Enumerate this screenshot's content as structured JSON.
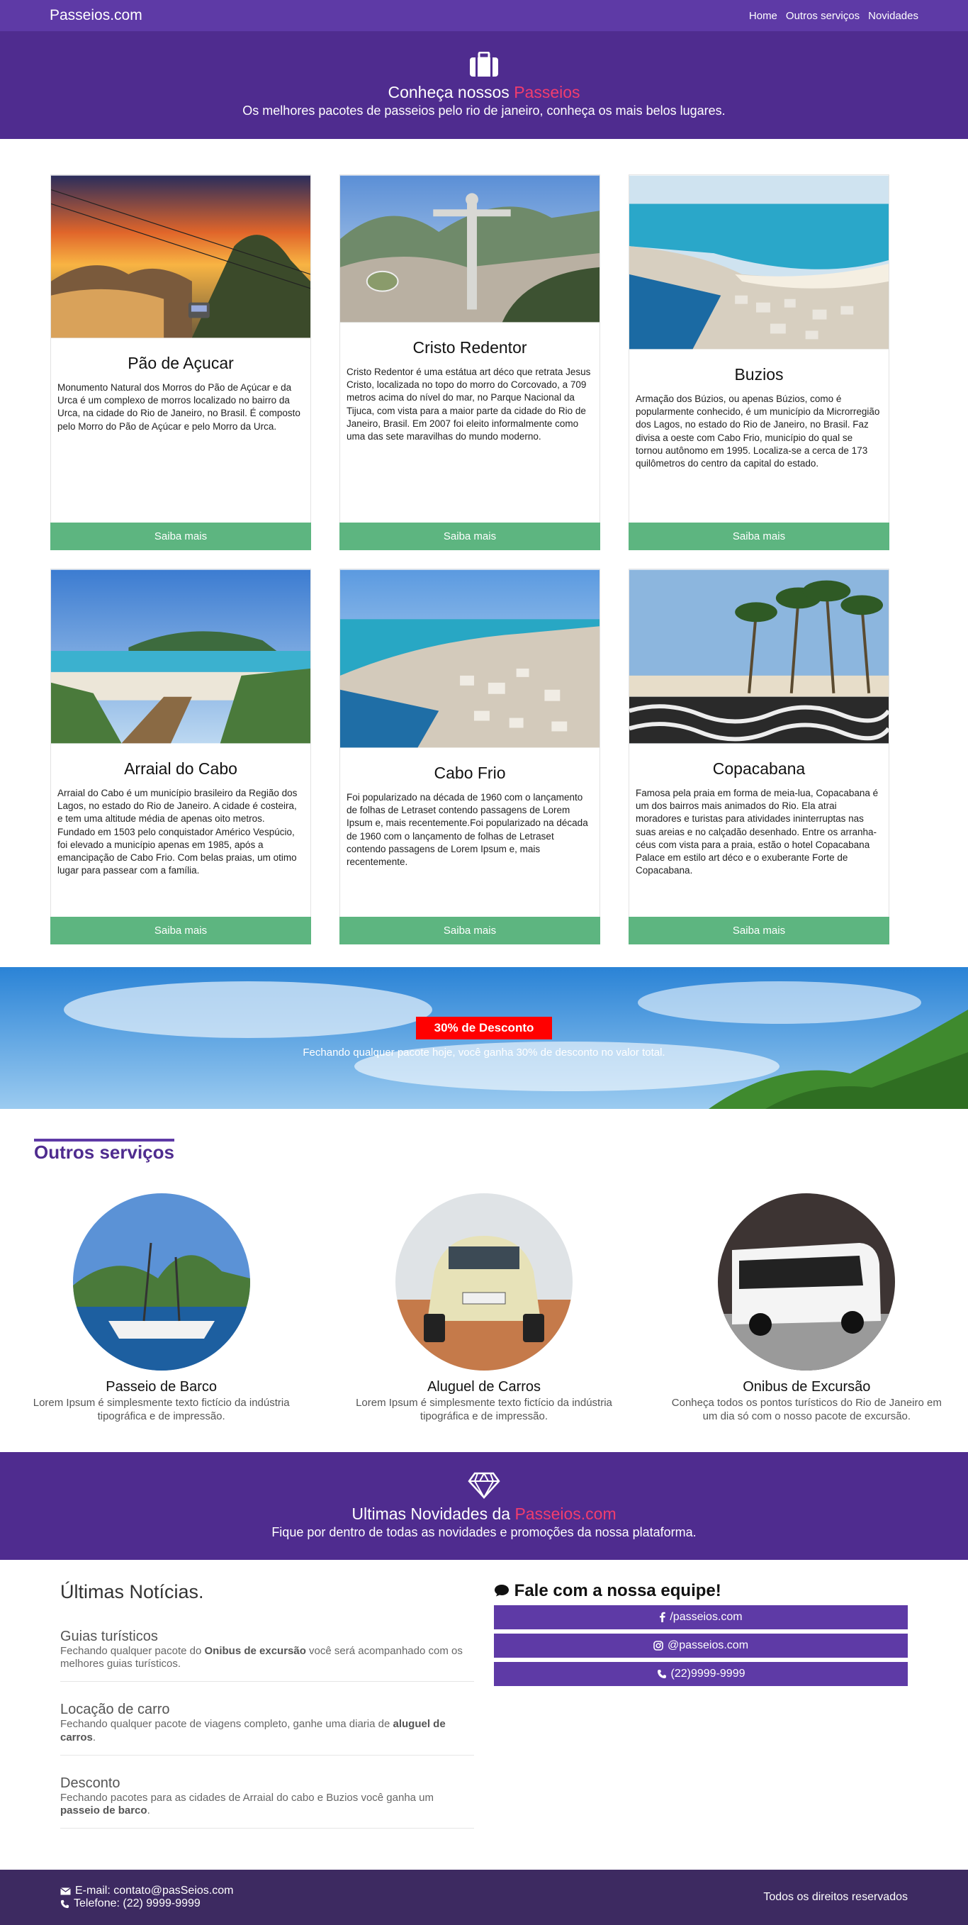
{
  "nav": {
    "brand": "Passeios.com",
    "links": [
      "Home",
      "Outros serviços",
      "Novidades"
    ]
  },
  "hero": {
    "title_prefix": "Conheça nossos ",
    "title_accent": "Passeios",
    "subtitle": "Os melhores pacotes de passeios pelo rio de janeiro, conheça os mais belos lugares."
  },
  "cards": [
    {
      "title": "Pão de Açucar",
      "text": "Monumento Natural dos Morros do Pão de Açúcar e da Urca é um complexo de morros localizado no bairro da Urca, na cidade do Rio de Janeiro, no Brasil. É composto pelo Morro do Pão de Açúcar e pelo Morro da Urca.",
      "button": "Saiba mais"
    },
    {
      "title": "Cristo Redentor",
      "text": "Cristo Redentor é uma estátua art déco que retrata Jesus Cristo, localizada no topo do morro do Corcovado, a 709 metros acima do nível do mar, no Parque Nacional da Tijuca, com vista para a maior parte da cidade do Rio de Janeiro, Brasil. Em 2007 foi eleito informalmente como uma das sete maravilhas do mundo moderno.",
      "button": "Saiba mais"
    },
    {
      "title": "Buzios",
      "text": "Armação dos Búzios, ou apenas Búzios, como é popularmente conhecido, é um município da Microrregião dos Lagos, no estado do Rio de Janeiro, no Brasil. Faz divisa a oeste com Cabo Frio, município do qual se tornou autônomo em 1995. Localiza-se a cerca de 173 quilômetros do centro da capital do estado.",
      "button": "Saiba mais"
    },
    {
      "title": "Arraial do Cabo",
      "text": "Arraial do Cabo é um município brasileiro da Região dos Lagos, no estado do Rio de Janeiro. A cidade é costeira, e tem uma altitude média de apenas oito metros. Fundado em 1503 pelo conquistador Américo Vespúcio, foi elevado a município apenas em 1985, após a emancipação de Cabo Frio. Com belas praias, um otimo lugar para passear com a família.",
      "button": "Saiba mais"
    },
    {
      "title": "Cabo Frio",
      "text": "Foi popularizado na década de 1960 com o lançamento de folhas de Letraset contendo passagens de Lorem Ipsum e, mais recentemente.Foi popularizado na década de 1960 com o lançamento de folhas de Letraset contendo passagens de Lorem Ipsum e, mais recentemente.",
      "button": "Saiba mais"
    },
    {
      "title": "Copacabana",
      "text": "Famosa pela praia em forma de meia-lua, Copacabana é um dos bairros mais animados do Rio. Ela atrai moradores e turistas para atividades ininterruptas nas suas areias e no calçadão desenhado. Entre os arranha-céus com vista para a praia, estão o hotel Copacabana Palace em estilo art déco e o exuberante Forte de Copacabana.",
      "button": "Saiba mais"
    }
  ],
  "promo": {
    "badge": "30% de Desconto",
    "text": "Fechando qualquer pacote hoje, você ganha 30% de desconto no valor total."
  },
  "services": {
    "title": "Outros serviços",
    "items": [
      {
        "title": "Passeio de Barco",
        "text": "Lorem Ipsum é simplesmente texto fictício da indústria tipográfica e de impressão."
      },
      {
        "title": "Aluguel de Carros",
        "text": "Lorem Ipsum é simplesmente texto fictício da indústria tipográfica e de impressão."
      },
      {
        "title": "Onibus de Excursão",
        "text": "Conheça todos os pontos turísticos do Rio de Janeiro em um dia só com o nosso pacote de excursão."
      }
    ]
  },
  "hero2": {
    "title_prefix": "Ultimas Novidades da ",
    "title_accent": "Passeios.com",
    "subtitle": "Fique por dentro de todas as novidades e promoções da nossa plataforma."
  },
  "news": {
    "title": "Últimas Notícias.",
    "items": [
      {
        "title": "Guias turísticos",
        "pre": "Fechando qualquer pacote do ",
        "bold": "Onibus de excursão",
        "post": " você será acompanhado com os melhores guias turísticos."
      },
      {
        "title": "Locação de carro",
        "pre": "Fechando qualquer pacote de viagens completo, ganhe uma diaria de ",
        "bold": "aluguel de carros",
        "post": "."
      },
      {
        "title": "Desconto",
        "pre": "Fechando pacotes para as cidades de Arraial do cabo e Buzios você ganha um ",
        "bold": "passeio de barco",
        "post": "."
      }
    ]
  },
  "contact": {
    "title": "Fale com a nossa equipe!",
    "facebook": "/passeios.com",
    "instagram": "@passeios.com",
    "phone": "(22)9999-9999"
  },
  "footer": {
    "email": "E-mail: contato@pasSeios.com",
    "phone": "Telefone: (22) 9999-9999",
    "rights": "Todos os direitos reservados"
  },
  "colors": {
    "navbar": "#5e3aa6",
    "hero": "#4f2c8f",
    "accent": "#f23d6d",
    "button_green": "#5db580",
    "badge_red": "#ff0000",
    "footer": "#3d2a61"
  },
  "icons": [
    "suitcase-icon",
    "diamond-icon",
    "comment-icon",
    "facebook-icon",
    "instagram-icon",
    "phone-icon",
    "envelope-icon"
  ]
}
